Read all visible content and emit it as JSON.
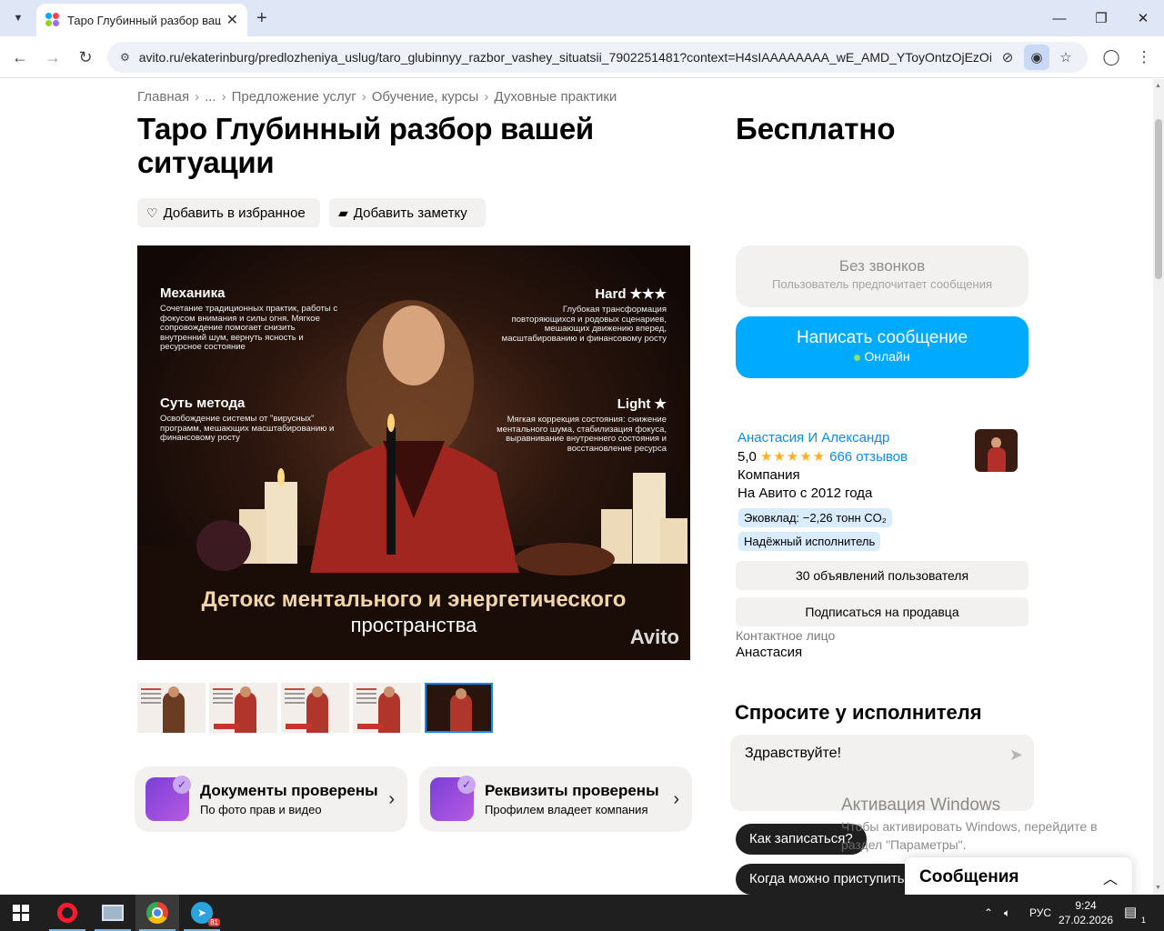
{
  "browser": {
    "tab_title": "Таро Глубинный разбор ваше",
    "url": "avito.ru/ekaterinburg/predlozheniya_uslug/taro_glubinnyy_razbor_vashey_situatsii_7902251481?context=H4sIAAAAAAAA_wE_AMD_YToyOntzOjEzOiJ...",
    "icons": {
      "tab_list": "chevron-down-icon",
      "close_tab": "close-icon",
      "new_tab": "plus-icon",
      "back": "arrow-left-icon",
      "forward": "arrow-right-icon",
      "reload": "reload-icon",
      "site_info": "tune-icon",
      "no_tracking": "eye-off-icon",
      "lens": "lens-icon",
      "bookmark": "star-icon",
      "profile": "profile-icon",
      "menu": "kebab-menu-icon"
    }
  },
  "breadcrumbs": [
    "Главная",
    "...",
    "Предложение услуг",
    "Обучение, курсы",
    "Духовные практики"
  ],
  "listing": {
    "title": "Таро Глубинный разбор вашей ситуации",
    "price": "Бесплатно",
    "favorite_label": "Добавить в избранное",
    "note_label": "Добавить заметку"
  },
  "image": {
    "tl_head": "Механика",
    "tl_text": "Сочетание традиционных практик, работы с фокусом внимания и силы огня. Мягкое сопровождение помогает снизить внутренний шум, вернуть ясность и ресурсное состояние",
    "tr_head": "Hard ★★★",
    "tr_text": "Глубокая трансформация повторяющихся и родовых сценариев, мешающих движению вперед, масштабированию и финансовому росту",
    "ml_head": "Суть метода",
    "ml_text": "Освобождение системы от \"вирусных\" программ, мешающих масштабированию и финансовому росту",
    "mr_head": "Light ★",
    "mr_text": "Мягкая коррекция состояния: снижение ментального шума, стабилизация фокуса, выравнивание внутреннего состояния и восстановление ресурса",
    "big": "Детокс ментального и энергетического",
    "sub": "пространства",
    "logo": "Avito"
  },
  "thumbnails": [
    {
      "caption": "ТАРО Глубинный разбор вашей ситуации"
    },
    {
      "caption": "1. КАРЬЕРА И ФИНАНСЫ"
    },
    {
      "caption": "2. ОТНОШЕНИЯ И ЛЮБОВЬ"
    },
    {
      "caption": "3. САМОРАЗВИТИЕ И РЕСУРС"
    },
    {
      "caption": "Детокс ментального и энергетического пространства"
    }
  ],
  "verifications": [
    {
      "title": "Документы проверены",
      "subtitle": "По фото прав и видео"
    },
    {
      "title": "Реквизиты проверены",
      "subtitle": "Профилем владеет компания"
    }
  ],
  "contact": {
    "no_calls_title": "Без звонков",
    "no_calls_sub": "Пользователь предпочитает сообщения",
    "message_btn": "Написать сообщение",
    "online": "Онлайн"
  },
  "seller": {
    "name": "Анастасия И Александр",
    "rating": "5,0",
    "stars": "★★★★★",
    "reviews": "666 отзывов",
    "type": "Компания",
    "since": "На Авито с 2012 года",
    "eco_badge": "Эковклад: −2,26 тонн CO₂",
    "reliable_badge": "Надёжный исполнитель",
    "ads_btn": "30 объявлений пользователя",
    "subscribe_btn": "Подписаться на продавца",
    "contact_label": "Контактное лицо",
    "contact_name": "Анастасия"
  },
  "ask": {
    "title": "Спросите у исполнителя",
    "message_value": "Здравствуйте!",
    "chips": [
      "Как записаться?",
      "Когда можно приступить"
    ]
  },
  "messages_bar": {
    "label": "Сообщения"
  },
  "windows_watermark": {
    "title": "Активация Windows",
    "line1": "Чтобы активировать Windows, перейдите в",
    "line2": "раздел \"Параметры\"."
  },
  "taskbar": {
    "telegram_badge": "81",
    "lang": "РУС",
    "time": "9:24",
    "date": "27.02.2026",
    "notifications": "1"
  },
  "colors": {
    "avito_blue": "#00aaff",
    "link_blue": "#0a8cf0",
    "star": "#ffb021",
    "grey_bg": "#f2f1f0",
    "badge_bg": "#d8ecfd"
  }
}
